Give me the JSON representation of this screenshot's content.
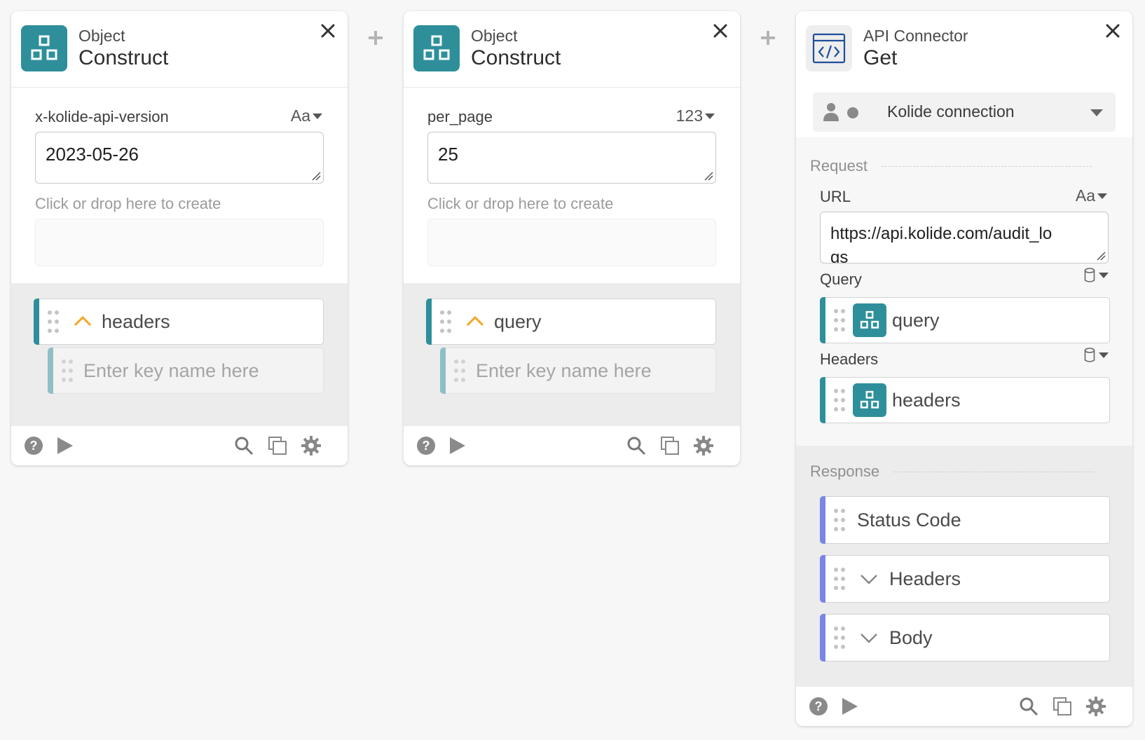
{
  "cards": [
    {
      "app": "Object",
      "operation": "Construct",
      "field_label": "x-kolide-api-version",
      "field_type": "Aa",
      "field_value": "2023-05-26",
      "drop_hint": "Click or drop here to create",
      "output_name": "headers",
      "key_placeholder": "Enter key name here"
    },
    {
      "app": "Object",
      "operation": "Construct",
      "field_label": "per_page",
      "field_type": "123",
      "field_value": "25",
      "drop_hint": "Click or drop here to create",
      "output_name": "query",
      "key_placeholder": "Enter key name here"
    }
  ],
  "api": {
    "app": "API Connector",
    "operation": "Get",
    "connection": "Kolide connection",
    "request_title": "Request",
    "url_label": "URL",
    "url_type": "Aa",
    "url_value": "https://api.kolide.com/audit_lo",
    "url_value_overflow": "gs",
    "query_label": "Query",
    "query_pill": "query",
    "headers_label": "Headers",
    "headers_pill": "headers",
    "response_title": "Response",
    "response_items": [
      "Status Code",
      "Headers",
      "Body"
    ]
  },
  "colors": {
    "teal": "#2e8f9b",
    "light_teal": "#8fbfc6",
    "orange": "#f5a623",
    "purple": "#7b85e6"
  }
}
